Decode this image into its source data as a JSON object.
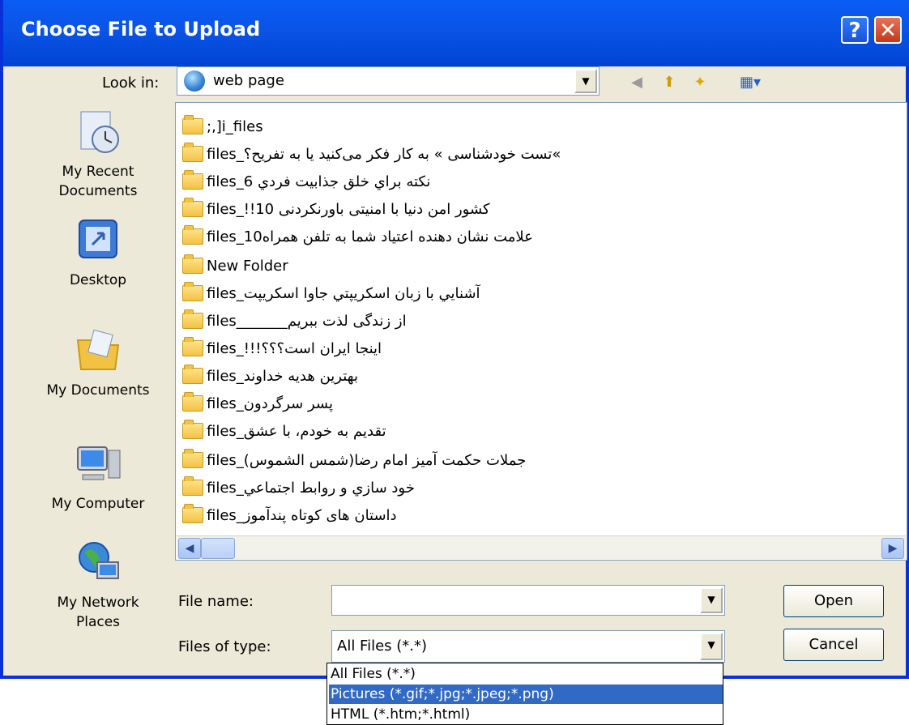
{
  "window": {
    "title": "Choose File to Upload"
  },
  "lookin": {
    "label": "Look in:",
    "value": "web page"
  },
  "places": [
    {
      "label": "My Recent Documents",
      "icon": "recent-documents-icon"
    },
    {
      "label": "Desktop",
      "icon": "desktop-icon"
    },
    {
      "label": "My Documents",
      "icon": "my-documents-icon"
    },
    {
      "label": "My Computer",
      "icon": "my-computer-icon"
    },
    {
      "label": "My Network Places",
      "icon": "network-places-icon"
    }
  ],
  "files": [
    ";,]i_files",
    "files_تست خودشناسی » به کار فکر می‌کنید یا به تفریح؟«",
    "files_نکته براي خلق جذابيت فردي 6",
    "files_!!کشور امن دنیا با امنیتی باورنکردنی 10",
    "files_10علامت نشان دهنده اعتیاد شما به تلفن همراه",
    "New Folder",
    "files_آشنايي با زبان اسکريپتي جاوا اسکريپت",
    "files_______از زندگی لذت ببریم",
    "files_!!!اینجا ایران است؟؟؟",
    "files_بهترین هدیه خداوند",
    "files_پسر سرگردون",
    "files_تقدیم به خودم، با عشق",
    "files_(جملات حکمت آمیز امام رضا(شمس الشموس",
    "files_خود سازي و روابط اجتماعي",
    "files_داستان های کوتاه پندآموز"
  ],
  "filename": {
    "label": "File name:",
    "value": ""
  },
  "filetype": {
    "label": "Files of type:",
    "value": "All Files (*.*)"
  },
  "buttons": {
    "open": "Open",
    "cancel": "Cancel"
  },
  "dropdown_options": [
    {
      "label": "All Files (*.*)",
      "selected": false
    },
    {
      "label": "Pictures (*.gif;*.jpg;*.jpeg;*.png)",
      "selected": true
    },
    {
      "label": "HTML (*.htm;*.html)",
      "selected": false
    }
  ],
  "colors": {
    "titlebar": "#0a54e6",
    "selection": "#316ac5",
    "window": "#ece9d8"
  }
}
